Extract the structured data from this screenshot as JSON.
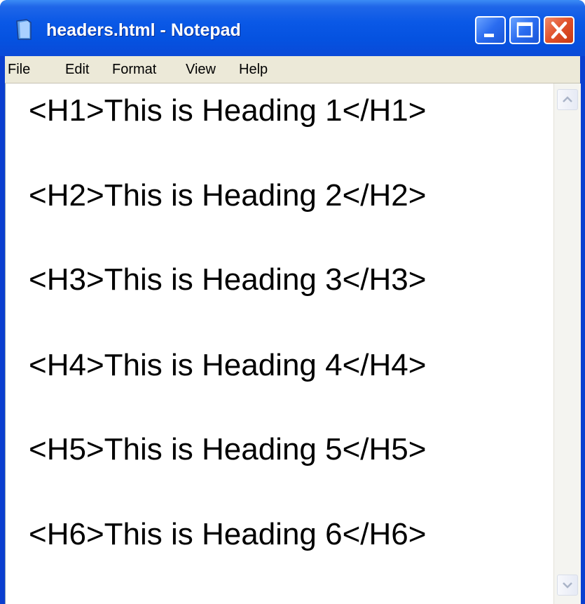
{
  "window": {
    "title": "headers.html - Notepad",
    "app_icon": "notepad-icon",
    "controls": {
      "minimize": "minimize-icon",
      "maximize": "maximize-icon",
      "close": "close-icon"
    }
  },
  "menu": {
    "items": [
      "File",
      "Edit",
      "Format",
      "View",
      "Help"
    ]
  },
  "editor": {
    "lines": [
      "<H1>This is Heading 1</H1>",
      "<H2>This is Heading 2</H2>",
      "<H3>This is Heading 3</H3>",
      "<H4>This is Heading 4</H4>",
      "<H5>This is Heading 5</H5>",
      "<H6>This is Heading 6</H6>"
    ]
  },
  "colors": {
    "titlebar": "#0a58e6",
    "close_button": "#e0502a",
    "menubar": "#ece9d8",
    "editor_background": "#ffffff",
    "text": "#000000"
  }
}
